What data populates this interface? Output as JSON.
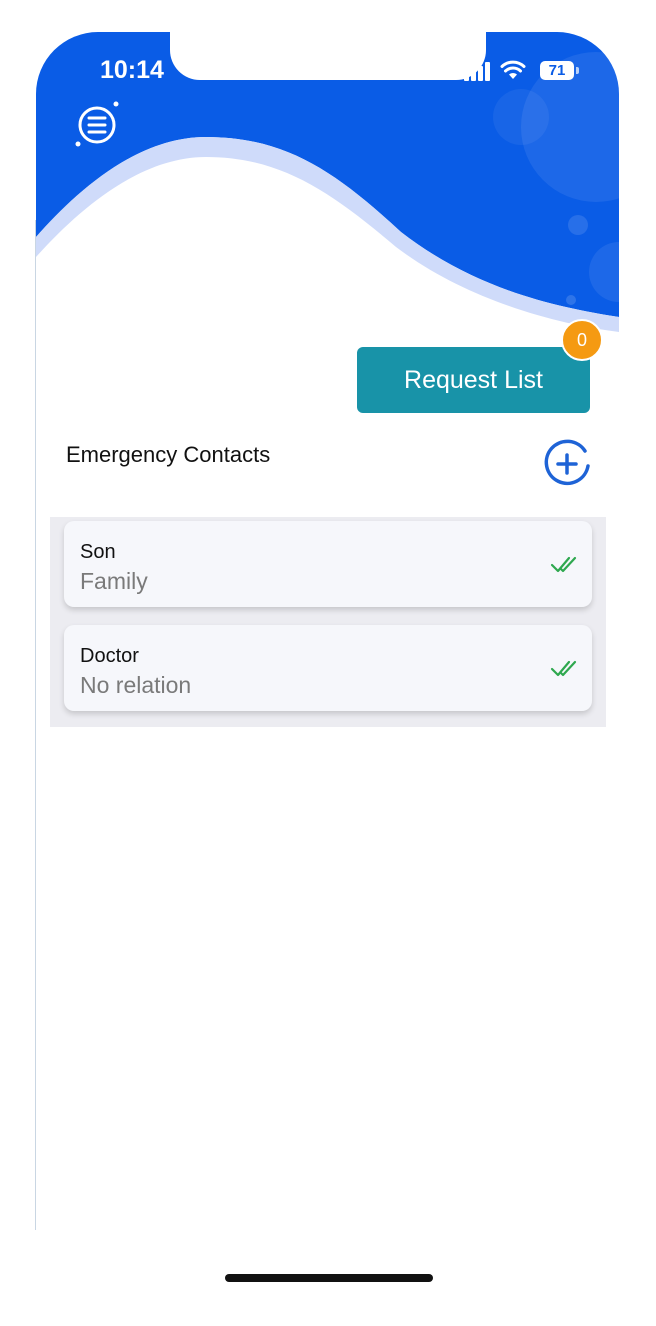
{
  "status_bar": {
    "time": "10:14",
    "battery": "71"
  },
  "colors": {
    "header_blue": "#0a5ce6",
    "request_button": "#1893a8",
    "badge_orange": "#f59a12",
    "add_icon_blue": "#1e63d6",
    "check_green": "#2fa84f"
  },
  "icons": {
    "menu": "menu-icon",
    "add": "add-circle-icon",
    "verified": "double-check-icon"
  },
  "request_list": {
    "label": "Request List",
    "badge_count": "0"
  },
  "section": {
    "title": "Emergency Contacts"
  },
  "contacts": [
    {
      "name": "Son",
      "relation": "Family"
    },
    {
      "name": "Doctor",
      "relation": "No relation"
    }
  ]
}
